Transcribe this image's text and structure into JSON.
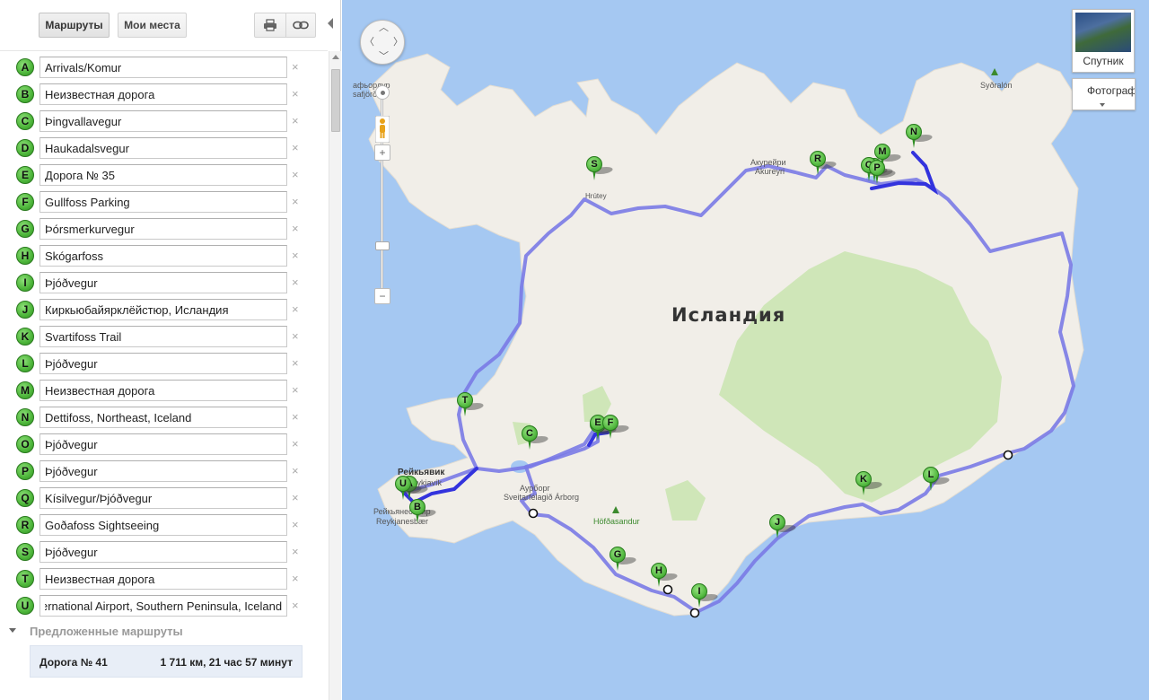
{
  "toolbar": {
    "routes_label": "Маршруты",
    "places_label": "Мои места"
  },
  "waypoints": [
    {
      "letter": "A",
      "value": "Arrivals/Komur"
    },
    {
      "letter": "B",
      "value": "Неизвестная дорога"
    },
    {
      "letter": "C",
      "value": "Þingvallavegur"
    },
    {
      "letter": "D",
      "value": "Haukadalsvegur"
    },
    {
      "letter": "E",
      "value": "Дорога № 35"
    },
    {
      "letter": "F",
      "value": "Gullfoss Parking"
    },
    {
      "letter": "G",
      "value": "Þórsmerkurvegur"
    },
    {
      "letter": "H",
      "value": "Skógarfoss"
    },
    {
      "letter": "I",
      "value": "Þjóðvegur"
    },
    {
      "letter": "J",
      "value": "Киркьюбайярклёйстюр, Исландия"
    },
    {
      "letter": "K",
      "value": "Svartifoss Trail"
    },
    {
      "letter": "L",
      "value": "Þjóðvegur"
    },
    {
      "letter": "M",
      "value": "Неизвестная дорога"
    },
    {
      "letter": "N",
      "value": "Dettifoss, Northeast, Iceland"
    },
    {
      "letter": "O",
      "value": "Þjóðvegur"
    },
    {
      "letter": "P",
      "value": "Þjóðvegur"
    },
    {
      "letter": "Q",
      "value": "Kísilvegur/Þjóðvegur"
    },
    {
      "letter": "R",
      "value": "Goðafoss Sightseeing"
    },
    {
      "letter": "S",
      "value": "Þjóðvegur"
    },
    {
      "letter": "T",
      "value": "Неизвестная дорога"
    },
    {
      "letter": "U",
      "value": "ernational Airport, Southern Peninsula, Iceland"
    }
  ],
  "remove_glyph": "×",
  "suggested": {
    "header": "Предложенные маршруты",
    "route_name": "Дорога № 41",
    "route_info": "1 711 км, 21 час 57 минут"
  },
  "map": {
    "country_label": "Исландия",
    "place_labels": {
      "akureyri_ru": "Акурейри",
      "akureyri": "Akureyri",
      "reykjavik_ru": "Рейкьявик",
      "reykjavik": "Reykjavík",
      "reykjanesbaer_ru": "Рейкьянесбайр",
      "reykjanesbaer": "Reykjanesbær",
      "arborg_ru": "Аурборг",
      "arborg": "Sveitarfélagið Árborg",
      "isafjordur": "афьордур",
      "isafjordur2": "safjörður",
      "hofdasandur": "Höfðasandur",
      "sydralon": "Syðralón",
      "hrutey": "Hrútey"
    },
    "satellite_label": "Спутник",
    "photo_label": "Фотографии",
    "route_color": "#7a7ae6",
    "active_route_color": "#3333dd",
    "land_color": "#f1eee8",
    "water_color": "#a5c8f2",
    "park_color": "#cfe6b8",
    "pin_color": "#56bb43"
  }
}
